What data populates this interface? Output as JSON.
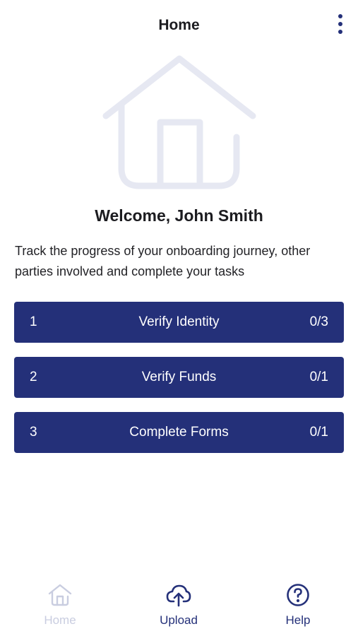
{
  "header": {
    "title": "Home",
    "menu_icon": "more-vertical-icon"
  },
  "hero": {
    "icon": "house-icon"
  },
  "welcome": {
    "title": "Welcome, John Smith",
    "description": "Track the progress of your onboarding journey, other parties involved and complete your tasks"
  },
  "tasks": [
    {
      "index": "1",
      "label": "Verify Identity",
      "progress": "0/3"
    },
    {
      "index": "2",
      "label": "Verify Funds",
      "progress": "0/1"
    },
    {
      "index": "3",
      "label": "Complete Forms",
      "progress": "0/1"
    }
  ],
  "bottom_nav": {
    "items": [
      {
        "label": "Home",
        "icon": "home-icon",
        "state": "disabled"
      },
      {
        "label": "Upload",
        "icon": "cloud-upload-icon",
        "state": "active"
      },
      {
        "label": "Help",
        "icon": "help-circle-icon",
        "state": "active"
      }
    ]
  },
  "colors": {
    "primary": "#243079",
    "inactive_nav": "#c9cde0",
    "hero_icon": "#e6e8f2",
    "text": "#1c1c20"
  }
}
